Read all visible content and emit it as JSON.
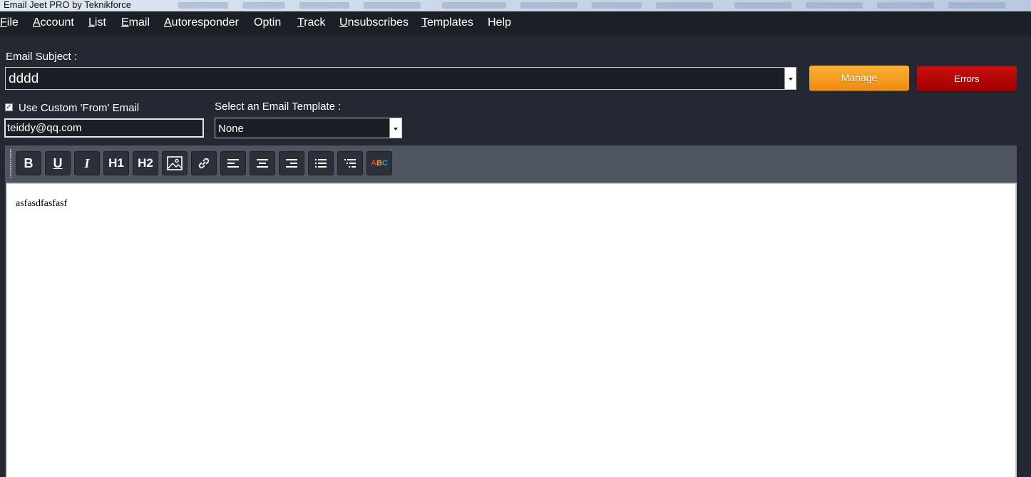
{
  "window": {
    "title": "Email Jeet PRO by Teknikforce"
  },
  "menu": [
    {
      "label": "File"
    },
    {
      "label": "Account"
    },
    {
      "label": "List"
    },
    {
      "label": "Email"
    },
    {
      "label": "Autoresponder"
    },
    {
      "label": "Optin"
    },
    {
      "label": "Track"
    },
    {
      "label": "Unsubscribes"
    },
    {
      "label": "Templates"
    },
    {
      "label": "Help"
    }
  ],
  "subject": {
    "label": "Email Subject :",
    "value": "dddd"
  },
  "buttons": {
    "manage": "Manage",
    "errors": "Errors"
  },
  "custom_from": {
    "label": "Use Custom 'From' Email",
    "checked": true,
    "value": "teiddy@qq.com"
  },
  "template": {
    "label": "Select an Email Template :",
    "selected": "None"
  },
  "toolbar": {
    "bold": "B",
    "underline": "U",
    "italic": "I",
    "h1": "H1",
    "h2": "H2",
    "spellcheck": {
      "a": "A",
      "b": "B",
      "c": "C"
    }
  },
  "editor": {
    "content": "asfasdfasfasf"
  },
  "colors": {
    "background": "#232833",
    "menubar": "#1b1f26",
    "toolbar": "#4f5561",
    "manage": "#f39a1c",
    "errors": "#b80606"
  }
}
